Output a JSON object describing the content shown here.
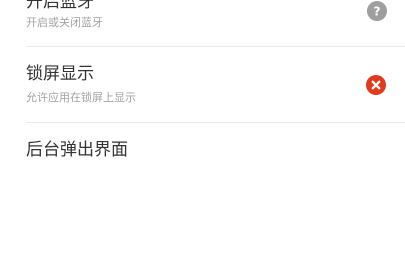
{
  "colors": {
    "text_primary": "#333333",
    "text_secondary": "#a3a3a3",
    "divider": "#ebebeb",
    "status_unknown": "#9e9e9e",
    "status_error": "#e13a1e"
  },
  "permissions": {
    "items": [
      {
        "title": "开启蓝牙",
        "subtitle": "开启或关闭蓝牙",
        "status_icon": "question-icon",
        "status": "unknown"
      },
      {
        "title": "锁屏显示",
        "subtitle": "允许应用在锁屏上显示",
        "status_icon": "close-icon",
        "status": "denied"
      },
      {
        "title": "后台弹出界面"
      }
    ]
  }
}
